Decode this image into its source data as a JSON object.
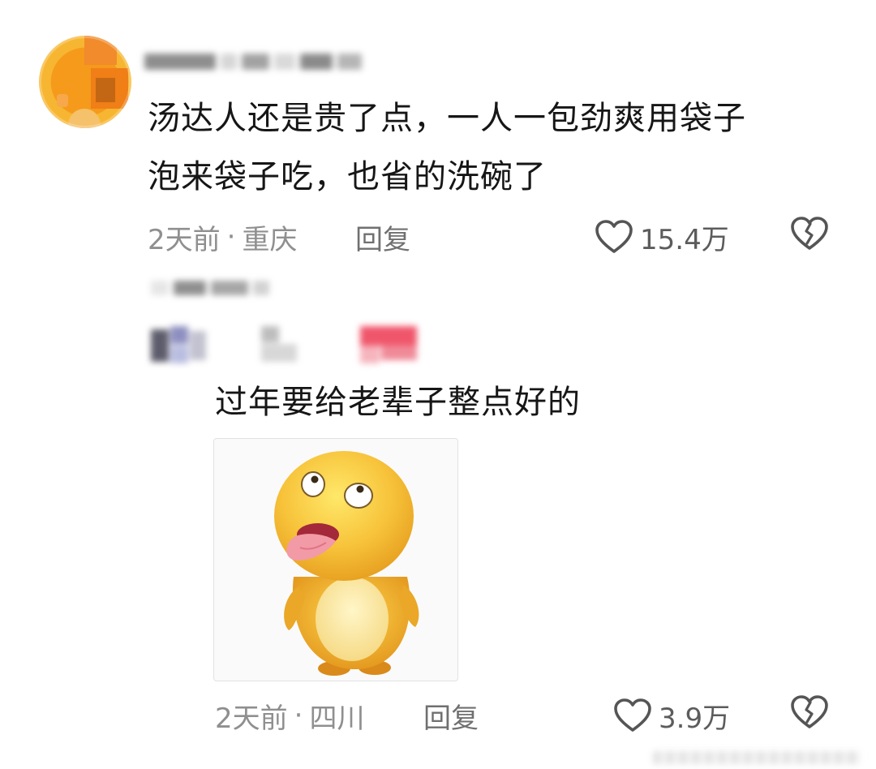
{
  "comment1": {
    "username": "",
    "text_line1": "汤达人还是贵了点，一人一包劲爽用袋子",
    "text_line2": "泡来袋子吃，也省的洗碗了",
    "time": "2天前",
    "sep": "·",
    "location": "重庆",
    "reply_label": "回复",
    "likes": "15.4万"
  },
  "comment2": {
    "username": "",
    "text": "过年要给老辈子整点好的",
    "time": "2天前",
    "sep": "·",
    "location": "四川",
    "reply_label": "回复",
    "likes": "3.9万"
  },
  "colors": {
    "text": "#161616",
    "meta": "#8f8f8f",
    "icon": "#555555",
    "accent_pink": "#f0566b",
    "avatar_orange": "#f59a1b"
  },
  "icons": [
    "heart-outline-icon",
    "broken-heart-icon"
  ]
}
